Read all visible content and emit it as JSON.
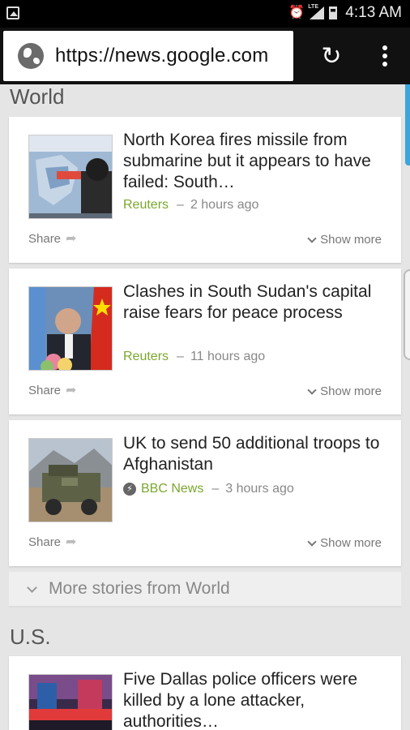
{
  "status_bar": {
    "time": "4:13 AM",
    "network": "LTE"
  },
  "browser": {
    "url": "https://news.google.com"
  },
  "sections": [
    {
      "title": "World",
      "more_label": "More stories from World",
      "articles": [
        {
          "headline": "North Korea fires missile from submarine but it appears to have failed: South…",
          "source": "Reuters",
          "time": "2 hours ago",
          "share": "Share",
          "show_more": "Show more"
        },
        {
          "headline": "Clashes in South Sudan's capital raise fears for peace process",
          "source": "Reuters",
          "time": "11 hours ago",
          "share": "Share",
          "show_more": "Show more"
        },
        {
          "headline": "UK to send 50 additional troops to Afghanistan",
          "source": "BBC News",
          "time": "3 hours ago",
          "share": "Share",
          "show_more": "Show more"
        }
      ]
    },
    {
      "title": "U.S.",
      "articles": [
        {
          "headline": "Five Dallas police officers were killed by a lone attacker, authorities…"
        }
      ]
    }
  ],
  "colors": {
    "source_green": "#7ba72e",
    "background": "#e5e5e5",
    "accent_blue": "#3aa7d8"
  }
}
